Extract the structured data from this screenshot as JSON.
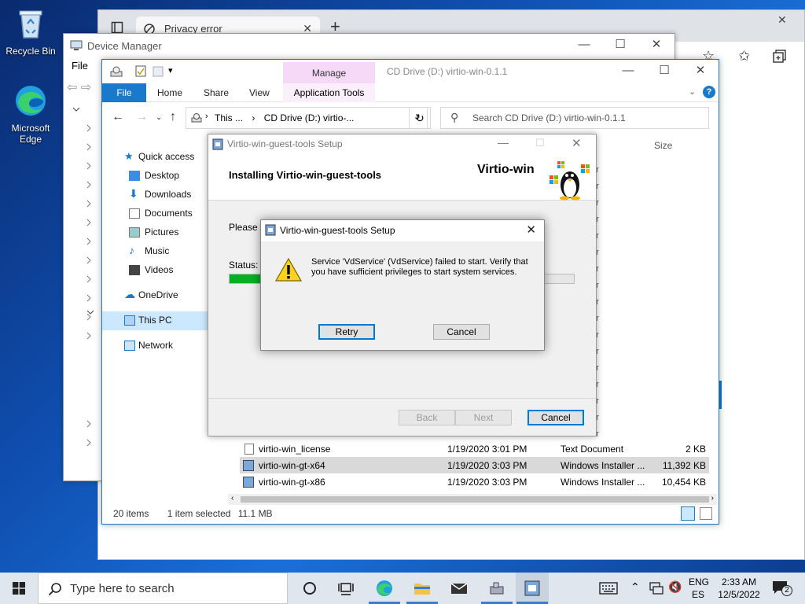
{
  "desktop": {
    "icons": [
      {
        "label": "Recycle Bin"
      },
      {
        "label": "Microsoft Edge"
      }
    ]
  },
  "edge": {
    "tab_title": "Privacy error",
    "tab_close": "✕",
    "new_tab": "+"
  },
  "device_manager": {
    "title": "Device Manager",
    "menu": [
      "File"
    ]
  },
  "explorer": {
    "title": "CD Drive (D:) virtio-win-0.1.1",
    "ribbon": {
      "manage": "Manage",
      "file": "File",
      "home": "Home",
      "share": "Share",
      "view": "View",
      "app_tools": "Application Tools"
    },
    "address": {
      "part1": "This ...",
      "part2": "CD Drive (D:) virtio-..."
    },
    "search_placeholder": "Search CD Drive (D:) virtio-win-0.1.1",
    "column_size": "Size",
    "nav": [
      {
        "label": "Quick access",
        "icon": "star-icon"
      },
      {
        "label": "Desktop",
        "icon": "desktop-icon"
      },
      {
        "label": "Downloads",
        "icon": "download-icon"
      },
      {
        "label": "Documents",
        "icon": "documents-icon"
      },
      {
        "label": "Pictures",
        "icon": "pictures-icon"
      },
      {
        "label": "Music",
        "icon": "music-icon"
      },
      {
        "label": "Videos",
        "icon": "videos-icon"
      },
      {
        "label": "OneDrive",
        "icon": "cloud-icon"
      },
      {
        "label": "This PC",
        "icon": "computer-icon"
      },
      {
        "label": "Network",
        "icon": "network-icon"
      }
    ],
    "files": [
      {
        "name": "virtio-win_license",
        "date": "1/19/2020 3:01 PM",
        "type": "Text Document",
        "size": "2 KB"
      },
      {
        "name": "virtio-win-gt-x64",
        "date": "1/19/2020 3:03 PM",
        "type": "Windows Installer ...",
        "size": "11,392 KB"
      },
      {
        "name": "virtio-win-gt-x86",
        "date": "1/19/2020 3:03 PM",
        "type": "Windows Installer ...",
        "size": "10,454 KB"
      }
    ],
    "type_peek": "er",
    "status": {
      "items": "20 items",
      "selected": "1 item selected",
      "size": "11.1 MB"
    }
  },
  "installer": {
    "title": "Virtio-win-guest-tools Setup",
    "heading": "Installing Virtio-win-guest-tools",
    "brand": "Virtio-win",
    "please_wait": "Please w",
    "status_label": "Status:",
    "progress": 0.12,
    "buttons": {
      "back": "Back",
      "next": "Next",
      "cancel": "Cancel"
    }
  },
  "error_dialog": {
    "title": "Virtio-win-guest-tools Setup",
    "message": "Service 'VdService' (VdService) failed to start.  Verify that you have sufficient privileges to start system services.",
    "retry": "Retry",
    "cancel": "Cancel"
  },
  "taskbar": {
    "search_placeholder": "Type here to search",
    "lang_top": "ENG",
    "lang_bottom": "ES",
    "time": "2:33 AM",
    "date": "12/5/2022",
    "notification_count": "2"
  },
  "colors": {
    "accent": "#0078d7",
    "progress": "#06b025",
    "manage_tab": "#f5d9f7"
  }
}
